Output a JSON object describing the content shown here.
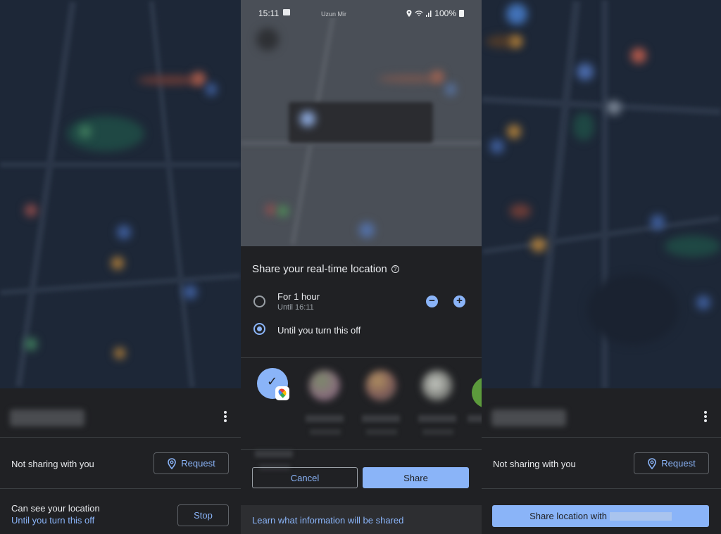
{
  "screens": {
    "left": {
      "contact_name": "[blurred contact name]",
      "not_sharing_label": "Not sharing with you",
      "request_label": "Request",
      "can_see_label": "Can see your location",
      "can_see_duration": "Until you turn this off",
      "stop_label": "Stop"
    },
    "middle": {
      "statusbar": {
        "time": "15:11",
        "carrier": "Uzun Mir",
        "battery": "100%"
      },
      "dialog": {
        "title": "Share your real-time location",
        "help_icon": "?",
        "options": [
          {
            "label": "For 1 hour",
            "sublabel": "Until 16:11",
            "selected": false
          },
          {
            "label": "Until you turn this off",
            "selected": true
          }
        ],
        "minus_label": "−",
        "plus_label": "+",
        "contacts": [
          {
            "name": "Google Maps",
            "selected": true,
            "check": "✓"
          },
          {
            "name": "[blurred]",
            "selected": false
          },
          {
            "name": "[blurred]",
            "selected": false
          },
          {
            "name": "[blurred]",
            "selected": false
          },
          {
            "name": "[blurred]",
            "selected": false
          }
        ],
        "cancel_label": "Cancel",
        "share_label": "Share",
        "learn_link": "Learn what information will be shared"
      }
    },
    "right": {
      "contact_name": "[blurred contact name]",
      "not_sharing_label": "Not sharing with you",
      "request_label": "Request",
      "share_with_label": "Share location with"
    }
  },
  "colors": {
    "accent": "#8ab4f8",
    "background": "#202124",
    "map_dark": "#1d2737",
    "text_primary": "#e8eaed",
    "text_secondary": "#9aa0a6"
  }
}
